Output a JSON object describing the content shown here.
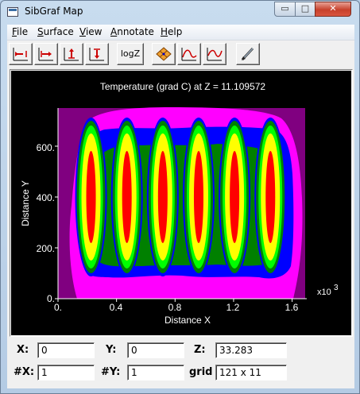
{
  "window": {
    "title": "SibGraf Map",
    "min_glyph": "▭",
    "max_glyph": "□",
    "close_glyph": "✕"
  },
  "menu": [
    {
      "accel": "F",
      "rest": "ile"
    },
    {
      "accel": "S",
      "rest": "urface"
    },
    {
      "accel": "V",
      "rest": "iew"
    },
    {
      "accel": "A",
      "rest": "nnotate"
    },
    {
      "accel": "H",
      "rest": "elp"
    }
  ],
  "toolbar": {
    "logz_label": "logZ",
    "icons": [
      "zoom-left-icon",
      "zoom-right-icon",
      "zoom-up-icon",
      "zoom-down-icon",
      "grid-points-icon",
      "curve-x-icon",
      "curve-y-icon",
      "pen-icon"
    ]
  },
  "plot": {
    "title": "Temperature (grad C) at Z = 11.109572",
    "xlabel": "Distance X",
    "ylabel": "Distance Y",
    "x_ticks": [
      "0.",
      "0.4",
      "0.8",
      "1.2",
      "1.6"
    ],
    "y_ticks": [
      "0.",
      "200.",
      "400.",
      "600."
    ],
    "x_multiplier": "x10",
    "x_multiplier_exp": "3",
    "colors": {
      "magenta": "#ff00ff",
      "purple": "#800080",
      "blue": "#0000ff",
      "green": "#008000",
      "lime": "#00ff00",
      "yellow": "#ffff00",
      "red": "#ff0000",
      "white": "#ffffff"
    }
  },
  "chart_data": {
    "type": "heatmap",
    "title": "Temperature (grad C) at Z = 11.109572",
    "xlabel": "Distance X",
    "ylabel": "Distance Y",
    "xlim": [
      0,
      1700
    ],
    "ylim": [
      0,
      750
    ],
    "x_tick_labels": [
      "0.",
      "0.4",
      "0.8",
      "1.2",
      "1.6"
    ],
    "y_tick_labels": [
      "0.",
      "200.",
      "400.",
      "600."
    ],
    "hotspot_x_centers": [
      230,
      480,
      730,
      980,
      1230,
      1480
    ],
    "hotspot_y_center": 400
  },
  "status": {
    "x_label": "X:",
    "x_value": "0",
    "y_label": "Y:",
    "y_value": "0",
    "z_label": "Z:",
    "z_value": "33.283",
    "nx_label": "#X:",
    "nx_value": "1",
    "ny_label": "#Y:",
    "ny_value": "1",
    "grid_label": "grid",
    "grid_value": "121 x 11"
  }
}
